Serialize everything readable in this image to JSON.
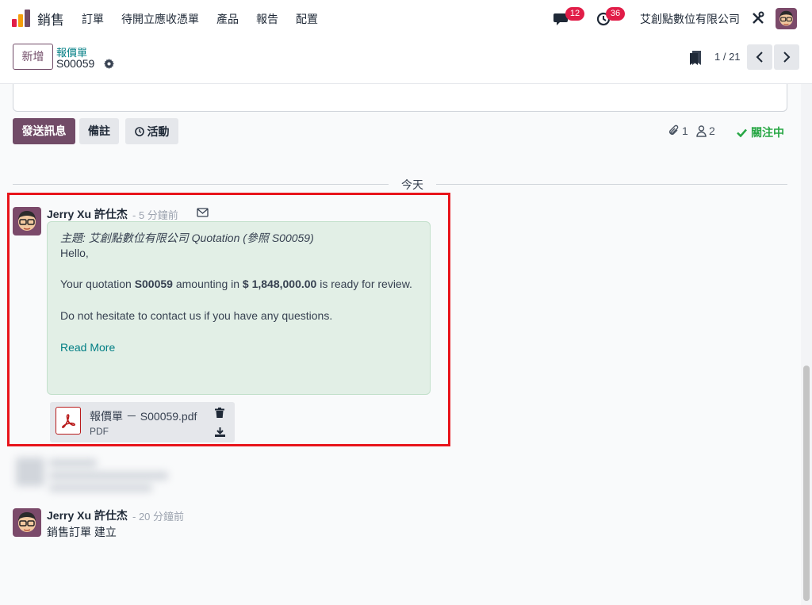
{
  "topnav": {
    "app_name": "銷售",
    "menu": [
      "訂單",
      "待開立應收憑單",
      "產品",
      "報告",
      "配置"
    ],
    "messages_count": "12",
    "activities_count": "36",
    "company": "艾創點數位有限公司"
  },
  "control_panel": {
    "new_button": "新增",
    "breadcrumb_parent": "報價單",
    "breadcrumb_current": "S00059",
    "pager": "1 / 21"
  },
  "chatter": {
    "send_message": "發送訊息",
    "log_note": "備註",
    "activities": "活動",
    "attachments_count": "1",
    "followers_count": "2",
    "following": "關注中",
    "day_separator": "今天"
  },
  "message1": {
    "author": "Jerry Xu 許仕杰",
    "time": "- 5 分鐘前",
    "subject": "主題: 艾創點數位有限公司 Quotation (參照 S00059)",
    "hello": "Hello,",
    "line2_pre": "Your quotation ",
    "line2_ref": "S00059",
    "line2_mid": " amounting in ",
    "line2_amount": "$ 1,848,000.00",
    "line2_post": " is ready for review.",
    "line3": "Do not hesitate to contact us if you have any questions.",
    "read_more": "Read More",
    "attachment_name": "報價單 － S00059.pdf",
    "attachment_type": "PDF"
  },
  "message2": {
    "author": "Jerry Xu 許仕杰",
    "time": "- 20 分鐘前",
    "body": "銷售訂單 建立"
  },
  "colors": {
    "primary": "#714b67",
    "link": "#017e84",
    "following": "#28a745",
    "badge": "#e11d48",
    "highlight": "#e8141b",
    "bubble": "#e2efe6"
  }
}
